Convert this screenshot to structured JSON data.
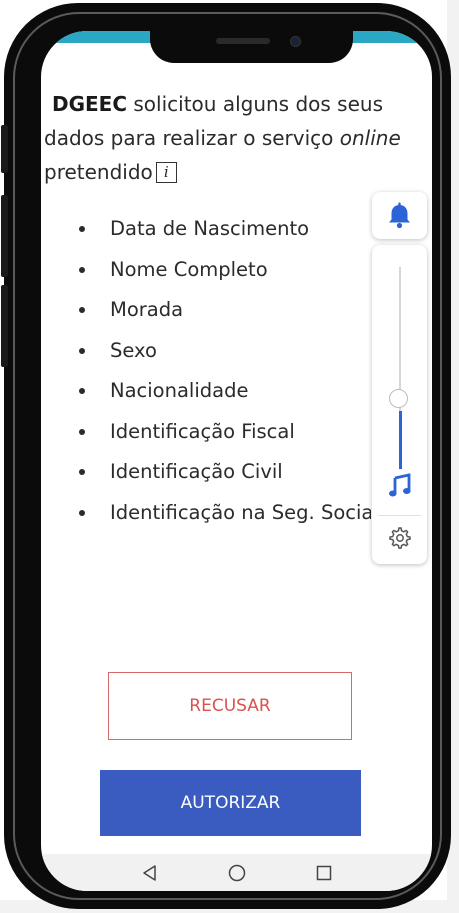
{
  "consent": {
    "org": "DGEEC",
    "text_before": " solicitou alguns dos seus dados para realizar o serviço ",
    "text_italic": "online",
    "text_after": " pretendido",
    "info_icon_label": "i"
  },
  "requested_data": [
    "Data de Nascimento",
    "Nome Completo",
    "Morada",
    "Sexo",
    "Nacionalidade",
    "Identificação Fiscal",
    "Identificação Civil",
    "Identificação na Seg. Social"
  ],
  "buttons": {
    "refuse_label": "RECUSAR",
    "authorize_label": "AUTORIZAR"
  },
  "volume": {
    "level": 0.27
  },
  "colors": {
    "status_bar": "#2aa7c3",
    "authorize_bg": "#3a5bc0",
    "refuse_text": "#d9534f",
    "volume_accent": "#2b64d6"
  },
  "icons": {
    "ringer": "bell-icon",
    "media": "music-note-icon",
    "settings": "gear-icon",
    "nav_back": "back-triangle-icon",
    "nav_home": "home-circle-icon",
    "nav_recents": "recents-square-icon"
  }
}
